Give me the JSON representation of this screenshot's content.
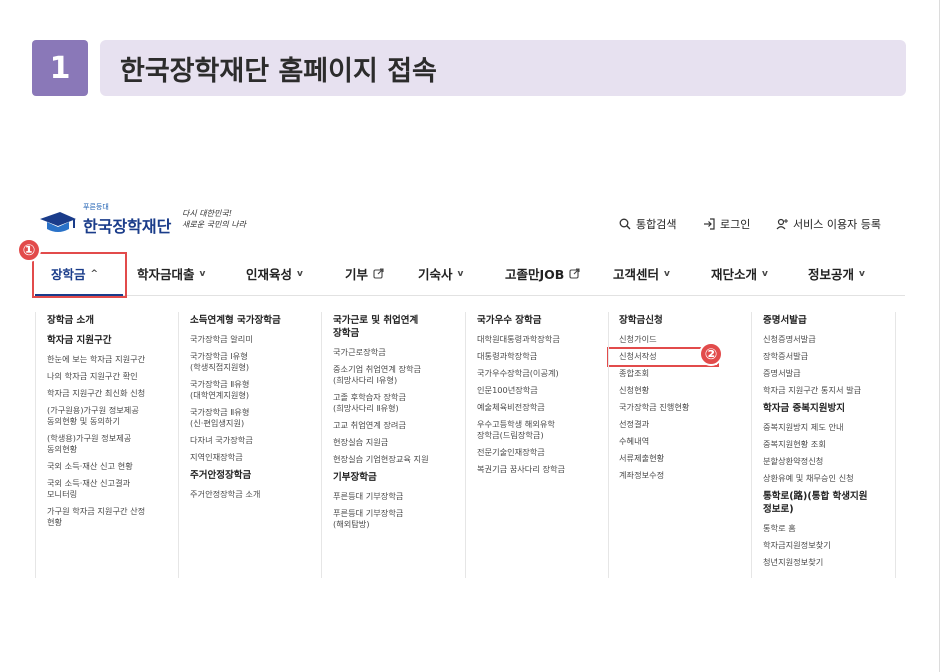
{
  "step": {
    "number": "1",
    "title": "한국장학재단 홈페이지 접속"
  },
  "header": {
    "logo": {
      "tagline_small": "푸른등대",
      "name": "한국장학재단",
      "slogan": "다시 대한민국!\n새로운 국민의 나라"
    },
    "utility": [
      {
        "label": "통합검색",
        "icon": "search-icon"
      },
      {
        "label": "로그인",
        "icon": "login-icon"
      },
      {
        "label": "서비스 이용자 등록",
        "icon": "user-add-icon"
      }
    ]
  },
  "nav": [
    {
      "label": "장학금",
      "chevron": "^",
      "active": true
    },
    {
      "label": "학자금대출",
      "chevron": "v"
    },
    {
      "label": "인재육성",
      "chevron": "v"
    },
    {
      "label": "기부",
      "external": true
    },
    {
      "label": "기숙사",
      "chevron": "v"
    },
    {
      "label": "고졸만JOB",
      "external": true
    },
    {
      "label": "고객센터",
      "chevron": "v"
    },
    {
      "label": "재단소개",
      "chevron": "v"
    },
    {
      "label": "정보공개",
      "chevron": "v"
    }
  ],
  "markers": {
    "one": "①",
    "two": "②"
  },
  "mega_menu": {
    "col1": [
      {
        "t": "장학금 소개",
        "h": true
      },
      {
        "t": "학자금 지원구간",
        "h": true
      },
      {
        "t": "한눈에 보는 학자금 지원구간"
      },
      {
        "t": "나의 학자금 지원구간 확인"
      },
      {
        "t": "학자금 지원구간 최신화 신청"
      },
      {
        "t": "(가구원용)가구원 정보제공\n동의현황 및 동의하기"
      },
      {
        "t": "(학생용)가구원 정보제공\n동의현황"
      },
      {
        "t": "국외 소득·재산 신고 현황"
      },
      {
        "t": "국외 소득·재산 신고결과\n모니터링"
      },
      {
        "t": "가구원 학자금 지원구간 산정\n현황"
      }
    ],
    "col2": [
      {
        "t": "소득연계형 국가장학금",
        "h": true
      },
      {
        "t": "국가장학금 알리미"
      },
      {
        "t": "국가장학금 Ⅰ유형\n(학생직접지원형)"
      },
      {
        "t": "국가장학금 Ⅱ유형\n(대학연계지원형)"
      },
      {
        "t": "국가장학금 Ⅱ유형\n(신·편입생지원)"
      },
      {
        "t": "다자녀 국가장학금"
      },
      {
        "t": "지역인재장학금"
      },
      {
        "t": "주거안정장학금",
        "h": true
      },
      {
        "t": "주거안정장학금 소개"
      }
    ],
    "col3": [
      {
        "t": "국가근로 및 취업연계\n장학금",
        "h": true
      },
      {
        "t": "국가근로장학금"
      },
      {
        "t": "중소기업 취업연계 장학금\n(희망사다리 Ⅰ유형)"
      },
      {
        "t": "고졸 후학습자 장학금\n(희망사다리 Ⅱ유형)"
      },
      {
        "t": "고교 취업연계 장려금"
      },
      {
        "t": "현장실습 지원금"
      },
      {
        "t": "현장실습 기업현장교육 지원"
      },
      {
        "t": "기부장학금",
        "h": true
      },
      {
        "t": "푸른등대 기부장학금"
      },
      {
        "t": "푸른등대 기부장학금\n(해외탐방)"
      }
    ],
    "col4": [
      {
        "t": "국가우수 장학금",
        "h": true
      },
      {
        "t": "대학원대통령과학장학금"
      },
      {
        "t": "대통령과학장학금"
      },
      {
        "t": "국가우수장학금(이공계)"
      },
      {
        "t": "인문100년장학금"
      },
      {
        "t": "예술체육비전장학금"
      },
      {
        "t": "우수고등학생 해외유학\n장학금(드림장학금)"
      },
      {
        "t": "전문기술인재장학금"
      },
      {
        "t": "복권기금 꿈사다리 장학금"
      }
    ],
    "col5": [
      {
        "t": "장학금신청",
        "h": true
      },
      {
        "t": "신청가이드"
      },
      {
        "t": "신청서작성"
      },
      {
        "t": "종합조회"
      },
      {
        "t": "신청현황"
      },
      {
        "t": "국가장학금 진행현황"
      },
      {
        "t": "선정결과"
      },
      {
        "t": "수혜내역"
      },
      {
        "t": "서류제출현황"
      },
      {
        "t": "계좌정보수정"
      }
    ],
    "col6": [
      {
        "t": "증명서발급",
        "h": true
      },
      {
        "t": "신청증명서발급"
      },
      {
        "t": "장학증서발급"
      },
      {
        "t": "증명서발급"
      },
      {
        "t": "학자금 지원구간 통지서 발급"
      },
      {
        "t": "학자금 중복지원방지",
        "h": true
      },
      {
        "t": "중복지원방지 제도 안내"
      },
      {
        "t": "중복지원현황 조회"
      },
      {
        "t": "분할상환약정신청"
      },
      {
        "t": "상환유예 및 채무승인 신청"
      },
      {
        "t": "통학로(路)(통합 학생지원\n정보로)",
        "h": true
      },
      {
        "t": "통학로 홈"
      },
      {
        "t": "학자금지원정보찾기"
      },
      {
        "t": "청년지원정보찾기"
      }
    ]
  }
}
